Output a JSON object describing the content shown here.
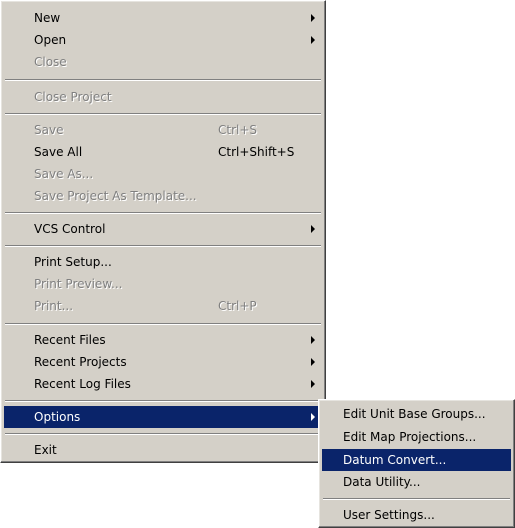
{
  "file_menu": {
    "new": {
      "label": "New"
    },
    "open": {
      "label": "Open"
    },
    "close": {
      "label": "Close"
    },
    "close_project": {
      "label": "Close Project"
    },
    "save": {
      "label": "Save",
      "shortcut": "Ctrl+S"
    },
    "save_all": {
      "label": "Save All",
      "shortcut": "Ctrl+Shift+S"
    },
    "save_as": {
      "label": "Save As..."
    },
    "save_project_as_template": {
      "label": "Save Project As Template..."
    },
    "vcs_control": {
      "label": "VCS Control"
    },
    "print_setup": {
      "label": "Print Setup..."
    },
    "print_preview": {
      "label": "Print Preview..."
    },
    "print": {
      "label": "Print...",
      "shortcut": "Ctrl+P"
    },
    "recent_files": {
      "label": "Recent Files"
    },
    "recent_projects": {
      "label": "Recent Projects"
    },
    "recent_log_files": {
      "label": "Recent Log Files"
    },
    "options": {
      "label": "Options"
    },
    "exit": {
      "label": "Exit"
    }
  },
  "options_menu": {
    "edit_unit_base_groups": {
      "label": "Edit Unit Base Groups..."
    },
    "edit_map_projections": {
      "label": "Edit Map Projections..."
    },
    "datum_convert": {
      "label": "Datum Convert..."
    },
    "data_utility": {
      "label": "Data Utility..."
    },
    "user_settings": {
      "label": "User Settings..."
    }
  },
  "colors": {
    "menu_background": "#d4d0c8",
    "selection_background": "#0a246a",
    "disabled_text": "#808080"
  }
}
